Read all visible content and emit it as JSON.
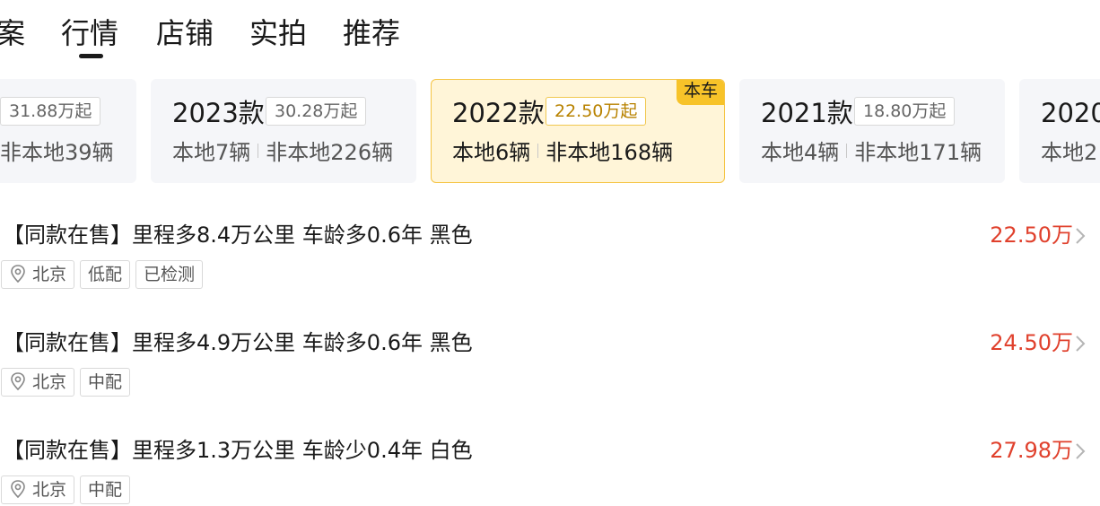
{
  "tabs": [
    {
      "label": "案"
    },
    {
      "label": "行情",
      "active": true
    },
    {
      "label": "店铺"
    },
    {
      "label": "实拍"
    },
    {
      "label": "推荐"
    }
  ],
  "year_cards": [
    {
      "year": "",
      "price": "31.88万起",
      "local": "",
      "nonlocal": "非本地39辆"
    },
    {
      "year": "2023款",
      "price": "30.28万起",
      "local": "本地7辆",
      "nonlocal": "非本地226辆"
    },
    {
      "year": "2022款",
      "price": "22.50万起",
      "local": "本地6辆",
      "nonlocal": "非本地168辆",
      "active": true,
      "badge": "本车"
    },
    {
      "year": "2021款",
      "price": "18.80万起",
      "local": "本地4辆",
      "nonlocal": "非本地171辆"
    },
    {
      "year": "2020",
      "price": "",
      "local": "本地2",
      "nonlocal": ""
    }
  ],
  "listings": [
    {
      "title": "【同款在售】里程多8.4万公里 车龄多0.6年 黑色",
      "price": "22.50万",
      "city": "北京",
      "tags": [
        "低配",
        "已检测"
      ]
    },
    {
      "title": "【同款在售】里程多4.9万公里 车龄多0.6年 黑色",
      "price": "24.50万",
      "city": "北京",
      "tags": [
        "中配"
      ]
    },
    {
      "title": "【同款在售】里程多1.3万公里 车龄少0.4年 白色",
      "price": "27.98万",
      "city": "北京",
      "tags": [
        "中配"
      ]
    }
  ],
  "colors": {
    "price_red": "#e0412d",
    "active_card_bg": "#fff5d8",
    "active_card_border": "#f5c443",
    "badge_yellow": "#f7c329",
    "card_bg": "#f5f6f9"
  },
  "icons": {
    "location": "location-pin-icon",
    "chevron": "chevron-right-icon"
  }
}
